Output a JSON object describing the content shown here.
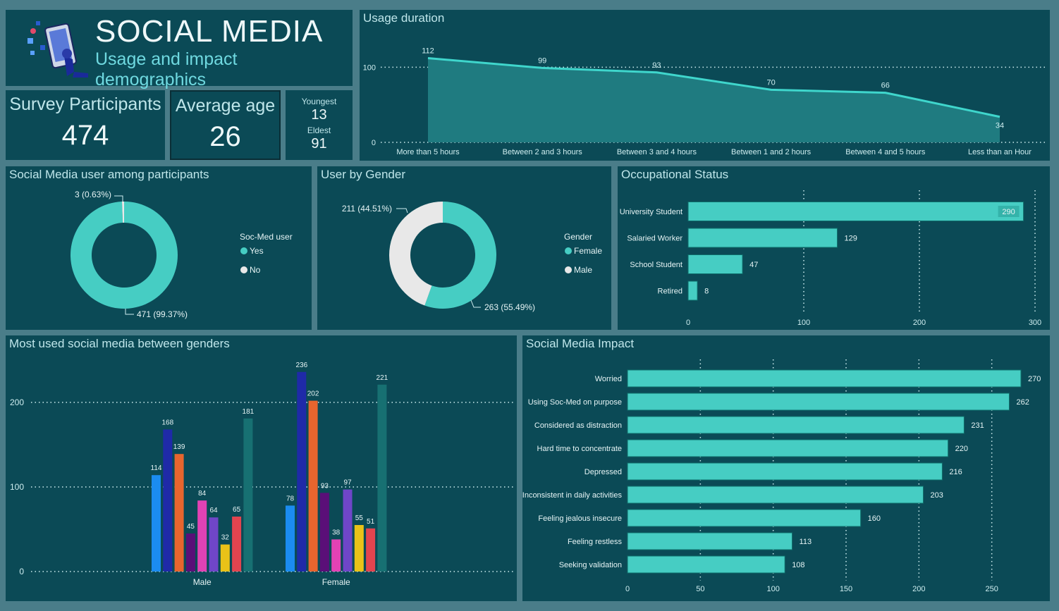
{
  "header": {
    "title": "SOCIAL MEDIA",
    "subtitle": "Usage and impact demographics",
    "illustration": "person-with-phone-illustration"
  },
  "kpis": {
    "participants": {
      "label": "Survey Participants",
      "value": "474"
    },
    "avg_age": {
      "label": "Average age",
      "value": "26"
    },
    "ages": {
      "youngest_label": "Youngest",
      "youngest": "13",
      "eldest_label": "Eldest",
      "eldest": "91"
    }
  },
  "colors": {
    "teal": "#46cdc3",
    "grey": "#e8e8e8",
    "panel": "#0b4a56",
    "background": "#4a7d89",
    "area_fill": "#1f7b80",
    "area_line": "#3fd6cc"
  },
  "chart_data": [
    {
      "id": "usage",
      "type": "area",
      "title": "Usage duration",
      "categories": [
        "More than 5 hours",
        "Between 2 and 3 hours",
        "Between 3 and 4 hours",
        "Between 1 and 2 hours",
        "Between 4 and 5 hours",
        "Less than an Hour"
      ],
      "values": [
        112,
        99,
        93,
        70,
        66,
        34
      ],
      "ylim": [
        0,
        120
      ],
      "yticks": [
        0,
        100
      ],
      "grid": true
    },
    {
      "id": "users",
      "type": "pie",
      "title": "Social Media user among participants",
      "legend_title": "Soc-Med user",
      "slices": [
        {
          "name": "Yes",
          "value": 471,
          "label": "471 (99.37%)",
          "color": "#46cdc3"
        },
        {
          "name": "No",
          "value": 3,
          "label": "3 (0.63%)",
          "color": "#e8e8e8"
        }
      ]
    },
    {
      "id": "gender",
      "type": "pie",
      "title": "User by Gender",
      "legend_title": "Gender",
      "slices": [
        {
          "name": "Female",
          "value": 263,
          "label": "263 (55.49%)",
          "color": "#46cdc3"
        },
        {
          "name": "Male",
          "value": 211,
          "label": "211 (44.51%)",
          "color": "#e8e8e8"
        }
      ]
    },
    {
      "id": "occupation",
      "type": "bar",
      "title": "Occupational Status",
      "orientation": "horizontal",
      "categories": [
        "University Student",
        "Salaried Worker",
        "School Student",
        "Retired"
      ],
      "values": [
        290,
        129,
        47,
        8
      ],
      "xlim": [
        0,
        300
      ],
      "xticks": [
        0,
        100,
        200,
        300
      ],
      "grid": true
    },
    {
      "id": "platforms",
      "type": "bar",
      "title": "Most used social media between genders",
      "categories": [
        "Male",
        "Female"
      ],
      "series": [
        {
          "values": [
            114,
            78
          ],
          "color": "#1b8cf0"
        },
        {
          "values": [
            168,
            236
          ],
          "color": "#1f2aa8"
        },
        {
          "values": [
            139,
            202
          ],
          "color": "#e8652e"
        },
        {
          "values": [
            45,
            93
          ],
          "color": "#5a0f78"
        },
        {
          "values": [
            84,
            38
          ],
          "color": "#e242b4"
        },
        {
          "values": [
            64,
            97
          ],
          "color": "#6f46c8"
        },
        {
          "values": [
            32,
            55
          ],
          "color": "#e9c218"
        },
        {
          "values": [
            65,
            51
          ],
          "color": "#e2444f"
        },
        {
          "values": [
            181,
            221
          ],
          "color": "#177072"
        }
      ],
      "ylim": [
        0,
        250
      ],
      "yticks": [
        0,
        100,
        200
      ],
      "grid": true
    },
    {
      "id": "impact",
      "type": "bar",
      "title": "Social Media Impact",
      "orientation": "horizontal",
      "categories": [
        "Worried",
        "Using Soc-Med on purpose",
        "Considered as distraction",
        "Hard time to concentrate",
        "Depressed",
        "Inconsistent in daily activities",
        "Feeling jealous insecure",
        "Feeling restless",
        "Seeking validation"
      ],
      "values": [
        270,
        262,
        231,
        220,
        216,
        203,
        160,
        113,
        108
      ],
      "xlim": [
        0,
        270
      ],
      "xticks": [
        0,
        50,
        100,
        150,
        200,
        250
      ],
      "grid": true
    }
  ]
}
